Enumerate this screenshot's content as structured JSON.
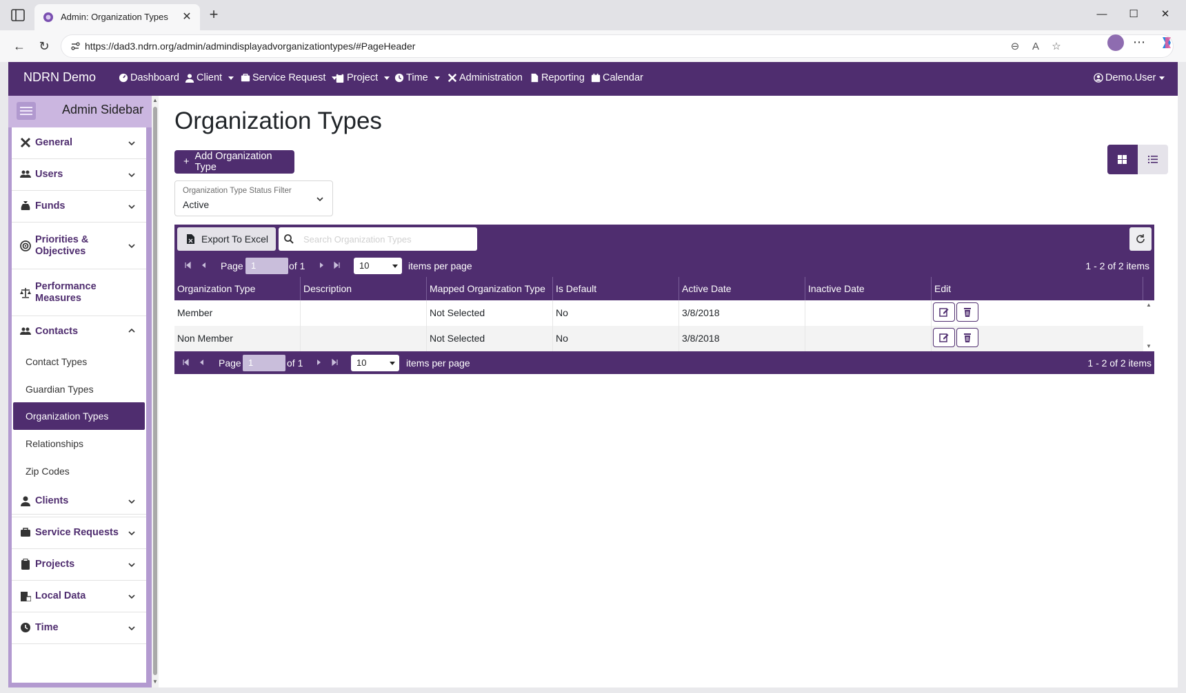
{
  "browser": {
    "tab_title": "Admin: Organization Types",
    "url": "https://dad3.ndrn.org/admin/admindisplayadvorganizationtypes/#PageHeader"
  },
  "navbar": {
    "brand": "NDRN Demo",
    "items": [
      {
        "label": "Dashboard",
        "icon": "dashboard-icon"
      },
      {
        "label": "Client",
        "icon": "user-icon"
      },
      {
        "label": "Service Request",
        "icon": "briefcase-icon"
      },
      {
        "label": "Project",
        "icon": "clipboard-icon"
      },
      {
        "label": "Time",
        "icon": "clock-icon"
      },
      {
        "label": "Administration",
        "icon": "tools-icon"
      },
      {
        "label": "Reporting",
        "icon": "file-icon"
      },
      {
        "label": "Calendar",
        "icon": "calendar-icon"
      }
    ],
    "user": "Demo.User"
  },
  "sidebar": {
    "title": "Admin Sidebar",
    "sections": [
      {
        "label": "General",
        "icon": "tools-icon"
      },
      {
        "label": "Users",
        "icon": "users-icon"
      },
      {
        "label": "Funds",
        "icon": "money-bag-icon"
      },
      {
        "label": "Priorities & Objectives",
        "icon": "target-icon"
      },
      {
        "label": "Performance Measures",
        "icon": "scale-icon"
      },
      {
        "label": "Contacts",
        "icon": "users-icon"
      },
      {
        "label": "Clients",
        "icon": "user-icon"
      },
      {
        "label": "Service Requests",
        "icon": "briefcase-icon"
      },
      {
        "label": "Projects",
        "icon": "clipboard-icon"
      },
      {
        "label": "Local Data",
        "icon": "building-lock-icon"
      },
      {
        "label": "Time",
        "icon": "clock-icon"
      }
    ],
    "contacts_items": [
      "Contact Types",
      "Guardian Types",
      "Organization Types",
      "Relationships",
      "Zip Codes"
    ],
    "active_item": "Organization Types"
  },
  "main": {
    "title": "Organization Types",
    "add_button": "Add Organization Type",
    "filter": {
      "label": "Organization Type Status Filter",
      "value": "Active"
    },
    "toolbar": {
      "export_label": "Export To Excel",
      "search_placeholder": "Search Organization Types"
    },
    "pager": {
      "page_label": "Page",
      "page_value": "1",
      "of_label": "of 1",
      "page_size": "10",
      "items_per_page": "items per page",
      "info": "1 - 2 of 2 items"
    },
    "columns": [
      "Organization Type",
      "Description",
      "Mapped Organization Type",
      "Is Default",
      "Active Date",
      "Inactive Date",
      "Edit"
    ],
    "rows": [
      [
        "Member",
        "",
        "Not Selected",
        "No",
        "3/8/2018",
        ""
      ],
      [
        "Non Member",
        "",
        "Not Selected",
        "No",
        "3/8/2018",
        ""
      ]
    ]
  },
  "colors": {
    "brand": "#4f2d6f",
    "sidebar": "#b39ad0"
  }
}
